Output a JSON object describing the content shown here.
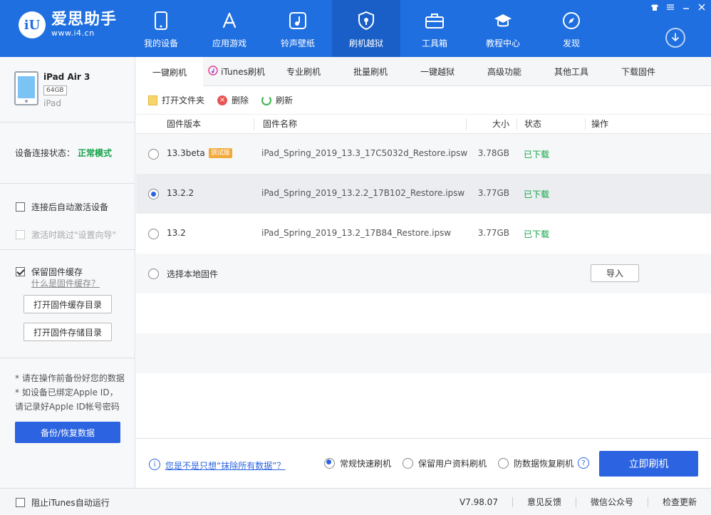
{
  "app": {
    "name": "爱思助手",
    "url": "www.i4.cn",
    "logo_mark": "iU"
  },
  "nav": [
    {
      "label": "我的设备",
      "icon": "phone-icon"
    },
    {
      "label": "应用游戏",
      "icon": "app-store-icon"
    },
    {
      "label": "铃声壁纸",
      "icon": "music-icon"
    },
    {
      "label": "刷机越狱",
      "icon": "shield-icon",
      "active": true
    },
    {
      "label": "工具箱",
      "icon": "toolbox-icon"
    },
    {
      "label": "教程中心",
      "icon": "graduation-cap-icon"
    },
    {
      "label": "发现",
      "icon": "compass-icon"
    }
  ],
  "device": {
    "name": "iPad Air 3",
    "capacity": "64GB",
    "type": "iPad"
  },
  "connection": {
    "label": "设备连接状态：",
    "status": "正常模式"
  },
  "options": {
    "auto_activate": "连接后自动激活设备",
    "skip_setup": "激活时跳过\"设置向导\"",
    "keep_cache": "保留固件缓存",
    "what_is_cache": "什么是固件缓存？",
    "open_cache_dir": "打开固件缓存目录",
    "open_store_dir": "打开固件存储目录"
  },
  "notes": {
    "line1": "* 请在操作前备份好您的数据",
    "line2": "* 如设备已绑定Apple ID，请记录好Apple ID帐号密码"
  },
  "backup_button": "备份/恢复数据",
  "tabs": [
    "一键刷机",
    "iTunes刷机",
    "专业刷机",
    "批量刷机",
    "一键越狱",
    "高级功能",
    "其他工具",
    "下载固件"
  ],
  "toolbar": {
    "open_folder": "打开文件夹",
    "delete": "删除",
    "refresh": "刷新"
  },
  "table": {
    "headers": {
      "version": "固件版本",
      "name": "固件名称",
      "size": "大小",
      "status": "状态",
      "action": "操作"
    },
    "rows": [
      {
        "version": "13.3beta",
        "badge": "测试版",
        "name": "iPad_Spring_2019_13.3_17C5032d_Restore.ipsw",
        "size": "3.78GB",
        "status": "已下载"
      },
      {
        "version": "13.2.2",
        "badge": "",
        "name": "iPad_Spring_2019_13.2.2_17B102_Restore.ipsw",
        "size": "3.77GB",
        "status": "已下载",
        "selected": true
      },
      {
        "version": "13.2",
        "badge": "",
        "name": "iPad_Spring_2019_13.2_17B84_Restore.ipsw",
        "size": "3.77GB",
        "status": "已下载"
      }
    ],
    "local": {
      "label": "选择本地固件",
      "import": "导入"
    }
  },
  "footer": {
    "help_link": "您是不是只想“抹除所有数据”？",
    "mode_fast": "常规快速刷机",
    "mode_keep": "保留用户资料刷机",
    "mode_antirecover": "防数据恢复刷机",
    "flash_button": "立即刷机"
  },
  "statusbar": {
    "block_itunes": "阻止iTunes自动运行",
    "version": "V7.98.07",
    "feedback": "意见反馈",
    "wechat": "微信公众号",
    "check_update": "检查更新"
  },
  "colors": {
    "brand": "#1f6fe0",
    "primary_button": "#2b63e0",
    "success": "#16a34a",
    "beta_badge": "#f3a93a"
  }
}
